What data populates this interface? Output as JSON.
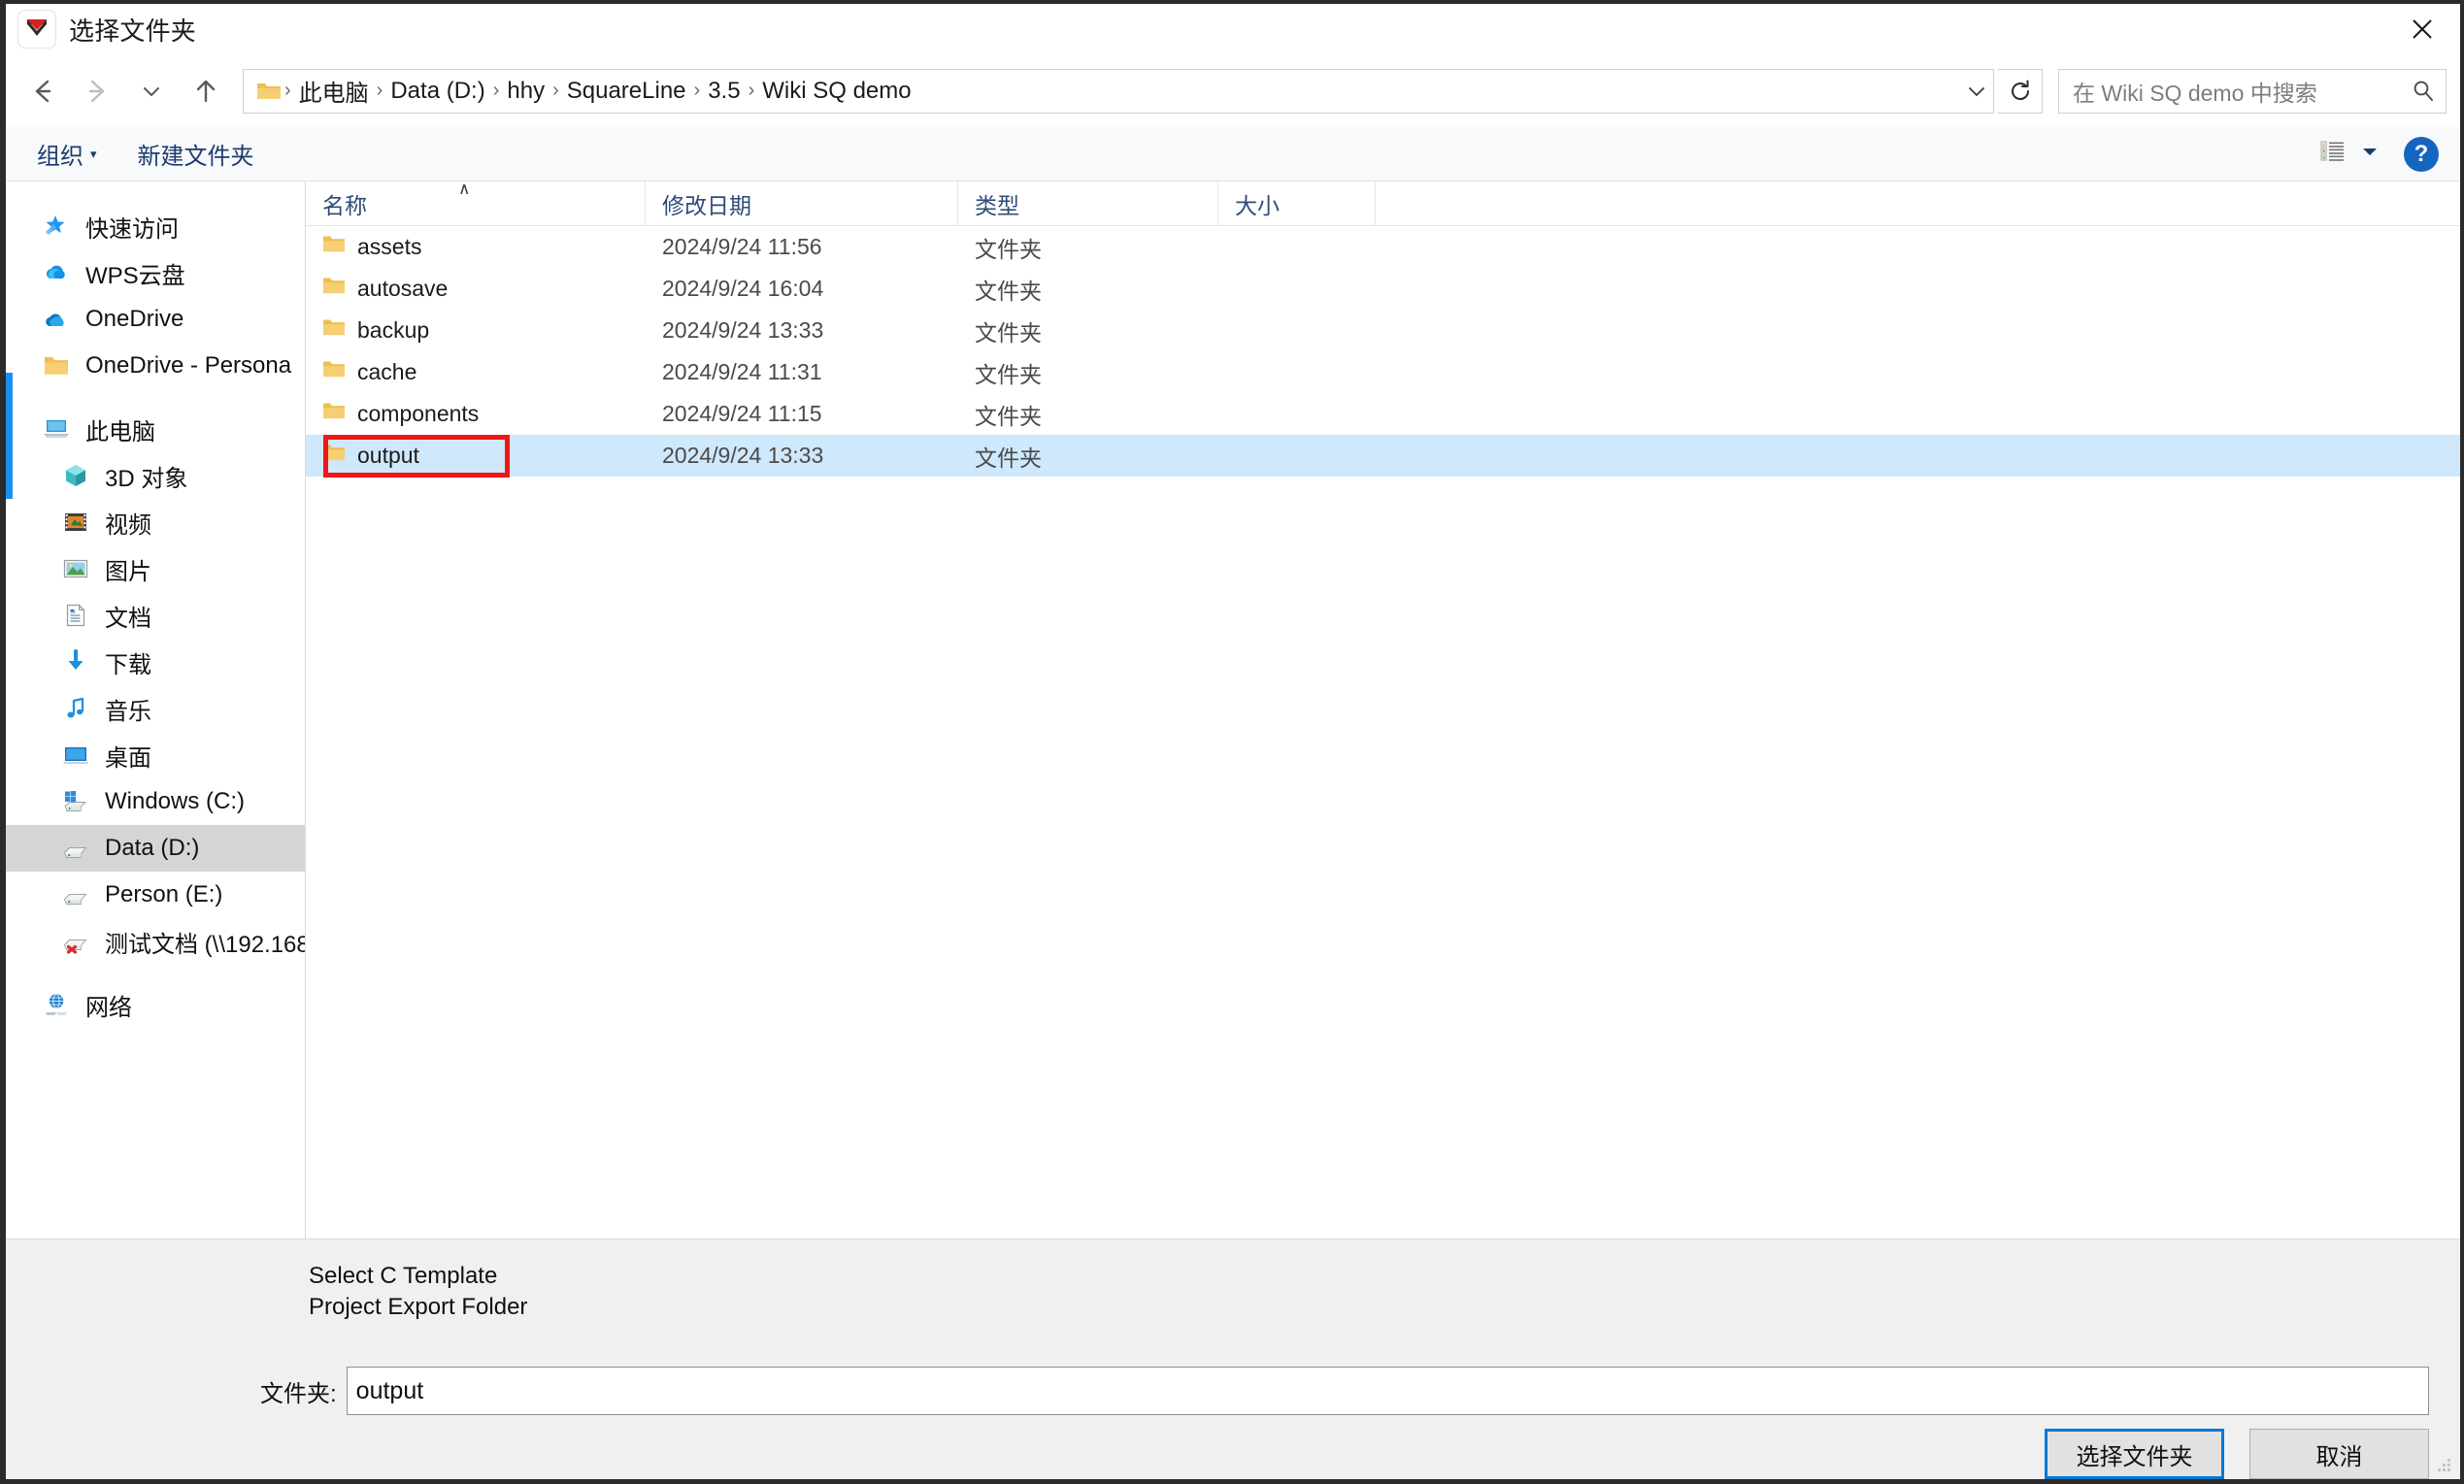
{
  "titlebar": {
    "title": "选择文件夹",
    "app_icon": "squareline-logo-icon",
    "close_label": "✕"
  },
  "nav": {
    "back_icon": "arrow-left-icon",
    "forward_icon": "arrow-right-icon",
    "recent_icon": "chevron-down-icon",
    "up_icon": "arrow-up-icon",
    "address_dropdown_icon": "chevron-down-icon",
    "refresh_icon": "refresh-icon",
    "breadcrumb": [
      "此电脑",
      "Data (D:)",
      "hhy",
      "SquareLine",
      "3.5",
      "Wiki SQ demo"
    ],
    "separator": "›"
  },
  "search": {
    "placeholder": "在 Wiki SQ demo 中搜索",
    "value": "",
    "icon": "search-icon"
  },
  "commandbar": {
    "organize_label": "组织",
    "organize_caret": "▾",
    "new_folder_label": "新建文件夹",
    "view_icon": "list-view-icon",
    "view_caret": "▾",
    "help_label": "?"
  },
  "sidebar": {
    "items": [
      {
        "label": "快速访问",
        "icon": "star-pin-icon",
        "indent": false,
        "selected": false
      },
      {
        "label": "WPS云盘",
        "icon": "wps-cloud-icon",
        "indent": false,
        "selected": false
      },
      {
        "label": "OneDrive",
        "icon": "onedrive-cloud-icon",
        "indent": false,
        "selected": false
      },
      {
        "label": "OneDrive - Persona",
        "icon": "folder-icon",
        "indent": false,
        "selected": false
      },
      {
        "label": "此电脑",
        "icon": "this-pc-icon",
        "indent": false,
        "selected": false
      },
      {
        "label": "3D 对象",
        "icon": "3d-objects-icon",
        "indent": true,
        "selected": false
      },
      {
        "label": "视频",
        "icon": "videos-icon",
        "indent": true,
        "selected": false
      },
      {
        "label": "图片",
        "icon": "pictures-icon",
        "indent": true,
        "selected": false
      },
      {
        "label": "文档",
        "icon": "documents-icon",
        "indent": true,
        "selected": false
      },
      {
        "label": "下载",
        "icon": "downloads-icon",
        "indent": true,
        "selected": false
      },
      {
        "label": "音乐",
        "icon": "music-icon",
        "indent": true,
        "selected": false
      },
      {
        "label": "桌面",
        "icon": "desktop-icon",
        "indent": true,
        "selected": false
      },
      {
        "label": "Windows (C:)",
        "icon": "windows-drive-icon",
        "indent": true,
        "selected": false
      },
      {
        "label": "Data (D:)",
        "icon": "drive-icon",
        "indent": true,
        "selected": true
      },
      {
        "label": "Person (E:)",
        "icon": "drive-icon",
        "indent": true,
        "selected": false
      },
      {
        "label": "测试文档 (\\\\192.168",
        "icon": "network-drive-offline-icon",
        "indent": true,
        "selected": false
      },
      {
        "label": "网络",
        "icon": "network-icon",
        "indent": false,
        "selected": false
      }
    ]
  },
  "filelist": {
    "columns": [
      "名称",
      "修改日期",
      "类型",
      "大小"
    ],
    "sort_caret": "∧",
    "rows": [
      {
        "name": "assets",
        "date": "2024/9/24 11:56",
        "type": "文件夹",
        "size": "",
        "selected": false
      },
      {
        "name": "autosave",
        "date": "2024/9/24 16:04",
        "type": "文件夹",
        "size": "",
        "selected": false
      },
      {
        "name": "backup",
        "date": "2024/9/24 13:33",
        "type": "文件夹",
        "size": "",
        "selected": false
      },
      {
        "name": "cache",
        "date": "2024/9/24 11:31",
        "type": "文件夹",
        "size": "",
        "selected": false
      },
      {
        "name": "components",
        "date": "2024/9/24 11:15",
        "type": "文件夹",
        "size": "",
        "selected": false
      },
      {
        "name": "output",
        "date": "2024/9/24 13:33",
        "type": "文件夹",
        "size": "",
        "selected": true
      }
    ]
  },
  "bottom": {
    "description": "Select C Template\nProject Export Folder",
    "folder_label": "文件夹:",
    "folder_value": "output",
    "select_button": "选择文件夹",
    "cancel_button": "取消"
  },
  "colors": {
    "selection_blue": "#cfe8fb",
    "annotation_red": "#f01717",
    "accent_blue": "#1b8ef2",
    "command_text": "#1c3c6e",
    "panel_gray": "#f0f0f0"
  }
}
